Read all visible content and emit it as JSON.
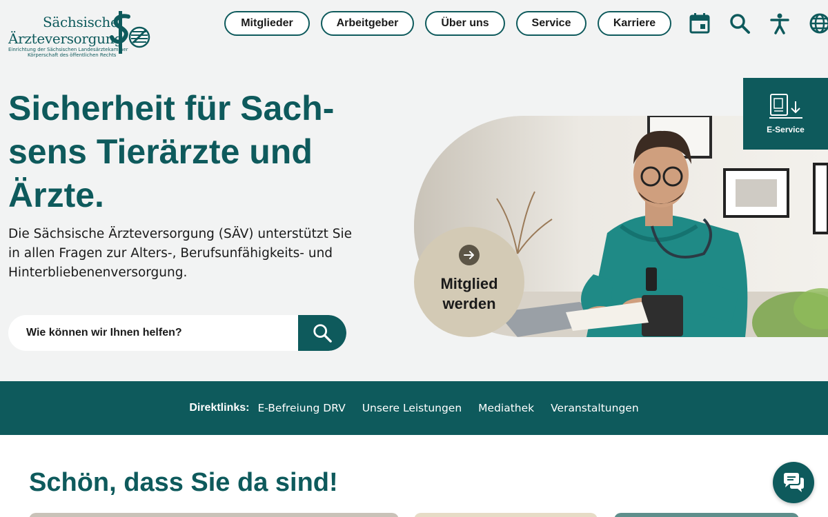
{
  "logo": {
    "name_line1": "Sächsische",
    "name_line2": "Ärzteversorgung",
    "sub_line1": "Einrichtung der Sächsischen Landesärztekammer",
    "sub_line2": "Körperschaft des öffentlichen Rechts"
  },
  "nav": {
    "items": [
      {
        "label": "Mitglieder"
      },
      {
        "label": "Arbeitgeber"
      },
      {
        "label": "Über uns"
      },
      {
        "label": "Service"
      },
      {
        "label": "Karriere"
      }
    ],
    "icons": [
      "calendar-icon",
      "search-icon",
      "accessibility-icon",
      "globe-icon"
    ]
  },
  "hero": {
    "title": "Sicherheit für Sach-sens Tierärzte und Ärzte.",
    "text": "Die Sächsische Ärzteversorgung (SÄV) unterstützt Sie in allen Fragen zur Alters-, Berufsunfähigkeits- und Hinterbliebenenversorgung.",
    "search_placeholder": "Wie können wir Ihnen helfen?",
    "cta_label": "Mitglied werden"
  },
  "eservice": {
    "label": "E-Service"
  },
  "direktlinks": {
    "title": "Direktlinks:",
    "links": [
      "E-Befreiung DRV",
      "Unsere Leistungen",
      "Mediathek",
      "Veranstaltungen"
    ]
  },
  "welcome": {
    "title": "Schön, dass Sie da sind!"
  },
  "colors": {
    "primary": "#0e5a5c",
    "cta_bg": "#d3cab5",
    "page_bg": "#f2f3f3"
  }
}
